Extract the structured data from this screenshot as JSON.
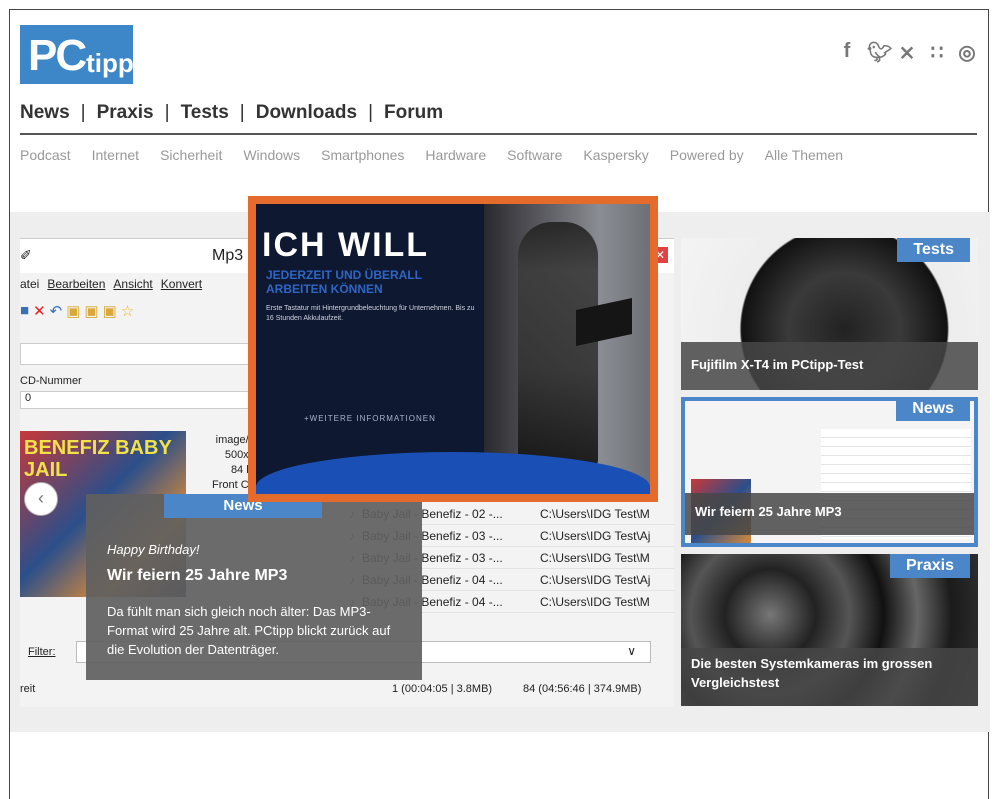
{
  "header": {
    "logo": {
      "pc": "PC",
      "tipp": "tipp"
    },
    "social_icons": [
      "facebook-icon",
      "twitter-icon",
      "xing-icon",
      "rss-icon",
      "instagram-icon"
    ],
    "social_glyphs": [
      "f",
      " y",
      "x",
      "◡",
      "◎"
    ]
  },
  "main_nav": [
    "News",
    "Praxis",
    "Tests",
    "Downloads",
    "Forum"
  ],
  "sub_nav": [
    "Podcast",
    "Internet",
    "Sicherheit",
    "Windows",
    "Smartphones",
    "Hardware",
    "Software",
    "Kaspersky",
    "Powered by",
    "Alle Themen"
  ],
  "slider": {
    "window": {
      "title": "Mp3",
      "menu": [
        "atei",
        "Bearbeiten",
        "Ansicht",
        "Konvert"
      ],
      "cd_label": "CD-Nummer",
      "cd_value": "0",
      "cover_text": "BENEFIZ BABY JAIL",
      "image_info": [
        "image/",
        "500x",
        "84 l",
        "Front C"
      ],
      "files": [
        {
          "name": "Baby Jail - Benefiz - 02 -...",
          "path": "C:\\Users\\IDG Test\\M"
        },
        {
          "name": "Baby Jail - Benefiz - 03 -...",
          "path": "C:\\Users\\IDG Test\\Aj"
        },
        {
          "name": "Baby Jail - Benefiz - 03 -...",
          "path": "C:\\Users\\IDG Test\\M"
        },
        {
          "name": "Baby Jail - Benefiz - 04 -...",
          "path": "C:\\Users\\IDG Test\\Aj"
        },
        {
          "name": "Baby Jail - Benefiz - 04 -...",
          "path": "C:\\Users\\IDG Test\\M"
        }
      ],
      "filter_label": "Filter:",
      "status_left": "reit",
      "status_mid": "1 (00:04:05 | 3.8MB)",
      "status_right": "84 (04:56:46 | 374.9MB)"
    },
    "prev_glyph": "‹",
    "tag": "News",
    "kicker": "Happy Birthday!",
    "headline": "Wir feiern 25 Jahre MP3",
    "teaser": "Da fühlt man sich gleich noch älter: Das MP3-Format wird 25 Jahre alt. PCtipp blickt zurück auf die Evolution der Datenträger."
  },
  "ad": {
    "headline": "ICH WILL",
    "sub": "JEDERZEIT UND ÜBERALL ARBEITEN KÖNNEN",
    "small": "Erste Tastatur mit Hintergrundbeleuchtung für Unternehmen. Bis zu 16 Stunden Akkulaufzeit.",
    "more": "+WEITERE INFORMATIONEN"
  },
  "cards": [
    {
      "tag": "Tests",
      "caption": "Fujifilm X-T4 im PCtipp-Test"
    },
    {
      "tag": "News",
      "caption": "Wir feiern 25 Jahre MP3"
    },
    {
      "tag": "Praxis",
      "caption": "Die besten Systemkameras im grossen Vergleichstest"
    }
  ]
}
